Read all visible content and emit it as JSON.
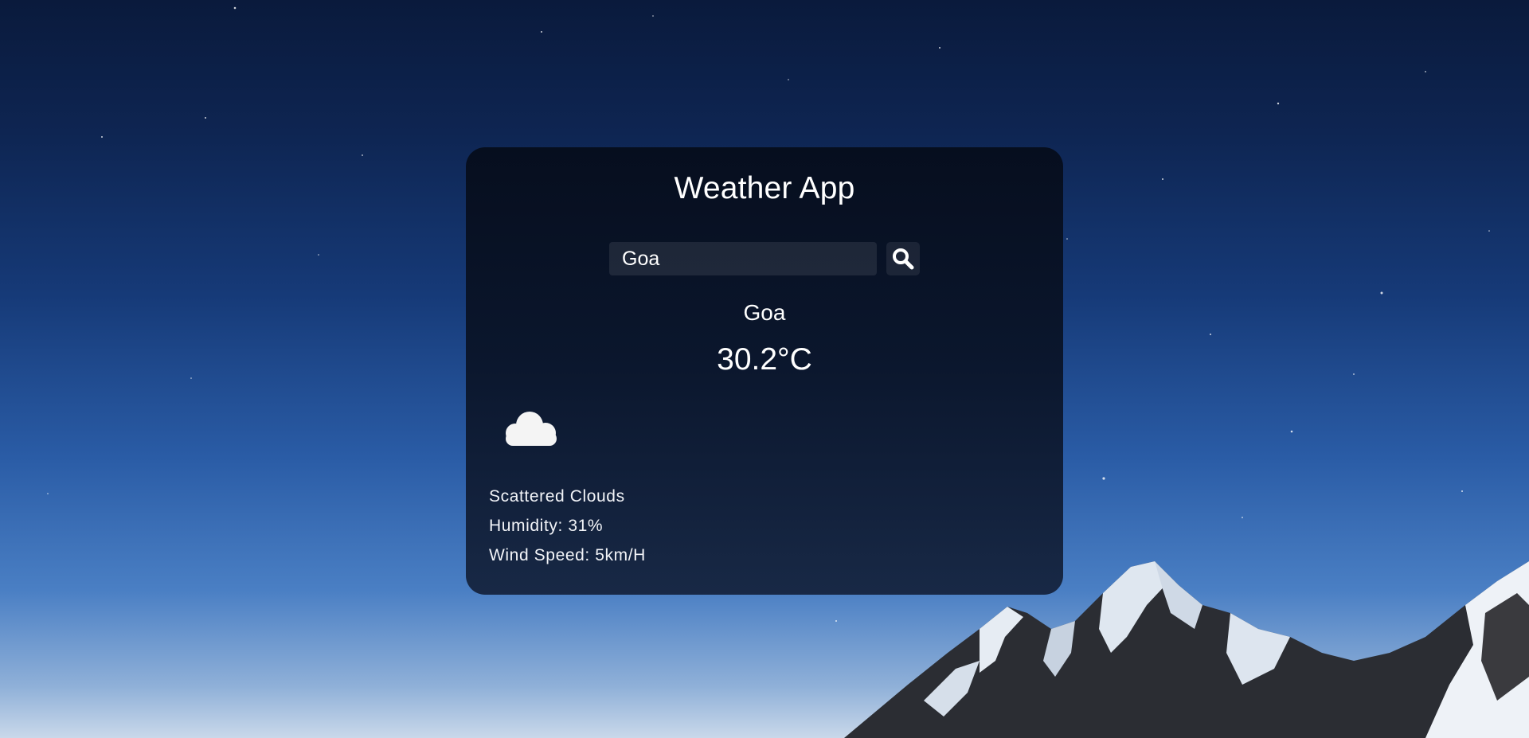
{
  "app": {
    "title": "Weather App"
  },
  "search": {
    "value": "Goa",
    "placeholder": "",
    "icon": "search-icon"
  },
  "weather": {
    "city": "Goa",
    "temperature": "30.2°C",
    "icon": "cloud-icon",
    "description": "Scattered Clouds",
    "humidity": "Humidity: 31%",
    "wind_speed": "Wind Speed: 5km/H"
  },
  "colors": {
    "text": "#ffffff",
    "card": "#0a1428",
    "sky_top": "#0a1a3c",
    "sky_bottom": "#4a7fc4"
  }
}
